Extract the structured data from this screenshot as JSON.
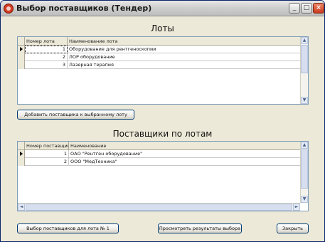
{
  "window": {
    "title": "Выбор поставщиков (Тендер)",
    "controls": {
      "minimize": "_",
      "maximize": "□",
      "close": "×"
    }
  },
  "lots": {
    "section_title": "Лоты",
    "columns": [
      "Номер лота",
      "Наименование лота"
    ],
    "rows": [
      {
        "number": "1",
        "name": "Оборудование для рентгеноскопии",
        "current": true
      },
      {
        "number": "2",
        "name": "ЛОР оборудование",
        "current": false
      },
      {
        "number": "3",
        "name": "Лазерная терапия",
        "current": false
      }
    ]
  },
  "add_supplier_button": "Добавить поставщика к выбранному лоту",
  "suppliers": {
    "section_title": "Поставщики по лотам",
    "columns": [
      "Номер поставщика",
      "Наименование"
    ],
    "rows": [
      {
        "number": "1",
        "name": "ОАО \"Рентген оборудование\"",
        "current": true
      },
      {
        "number": "2",
        "name": "ООО \"МедТехника\"",
        "current": false
      }
    ]
  },
  "footer": {
    "select_button": "Выбор поставщиков для лота № 1",
    "results_button": "Просмотреть результаты выбора",
    "close_button": "Закрыть"
  },
  "scrollbar_arrows": {
    "up": "▲",
    "down": "▼",
    "left": "◄",
    "right": "►"
  }
}
